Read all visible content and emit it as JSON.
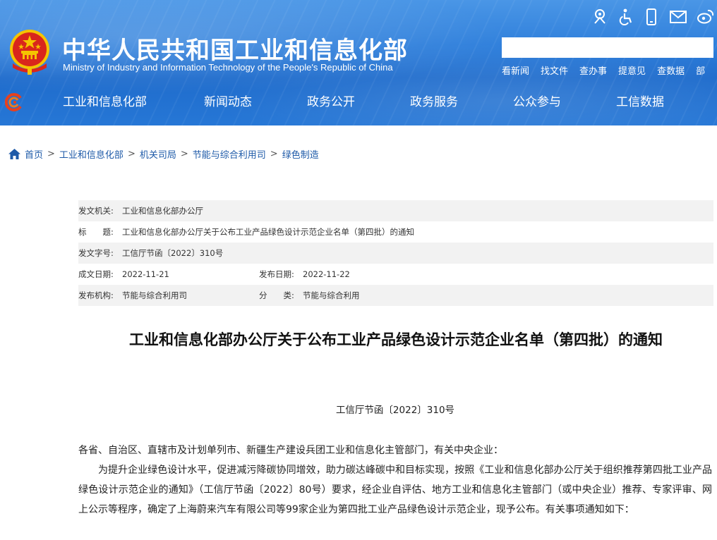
{
  "header": {
    "title_cn": "中华人民共和国工业和信息化部",
    "title_en": "Ministry of Industry and Information Technology of the People's Republic of China",
    "top_icons": [
      "elder-mode-icon",
      "accessibility-icon",
      "mobile-icon",
      "mail-icon",
      "weibo-icon"
    ],
    "search_placeholder": "",
    "quick_links": [
      "看新闻",
      "找文件",
      "查办事",
      "提意见",
      "查数据",
      "部"
    ]
  },
  "nav": {
    "items": [
      "工业和信息化部",
      "新闻动态",
      "政务公开",
      "政务服务",
      "公众参与",
      "工信数据"
    ]
  },
  "breadcrumb": {
    "items": [
      "首页",
      "工业和信息化部",
      "机关司局",
      "节能与综合利用司",
      "绿色制造"
    ],
    "separator": ">"
  },
  "meta": {
    "issuer_label": "发文机关:",
    "issuer": "工业和信息化部办公厅",
    "title_label": "标　　题:",
    "title": "工业和信息化部办公厅关于公布工业产品绿色设计示范企业名单（第四批）的通知",
    "docno_label": "发文字号:",
    "docno": "工信厅节函〔2022〕310号",
    "written_label": "成文日期:",
    "written": "2022-11-21",
    "published_label": "发布日期:",
    "published": "2022-11-22",
    "org_label": "发布机构:",
    "org": "节能与综合利用司",
    "category_label": "分　　类:",
    "category": "节能与综合利用"
  },
  "article": {
    "title": "工业和信息化部办公厅关于公布工业产品绿色设计示范企业名单（第四批）的通知",
    "doc_no": "工信厅节函〔2022〕310号",
    "salutation": "各省、自治区、直辖市及计划单列市、新疆生产建设兵团工业和信息化主管部门，有关中央企业：",
    "paragraph1": "为提升企业绿色设计水平，促进减污降碳协同增效，助力碳达峰碳中和目标实现，按照《工业和信息化部办公厅关于组织推荐第四批工业产品绿色设计示范企业的通知》（工信厅节函〔2022〕80号）要求，经企业自评估、地方工业和信息化主管部门（或中央企业）推荐、专家评审、网上公示等程序，确定了上海蔚来汽车有限公司等99家企业为第四批工业产品绿色设计示范企业，现予公布。有关事项通知如下："
  },
  "colors": {
    "header_blue": "#2f7fdb",
    "link_blue": "#1e5aa8",
    "meta_shade": "#f2f2f2",
    "emblem_red": "#d9261c",
    "emblem_gold": "#f5c400"
  }
}
